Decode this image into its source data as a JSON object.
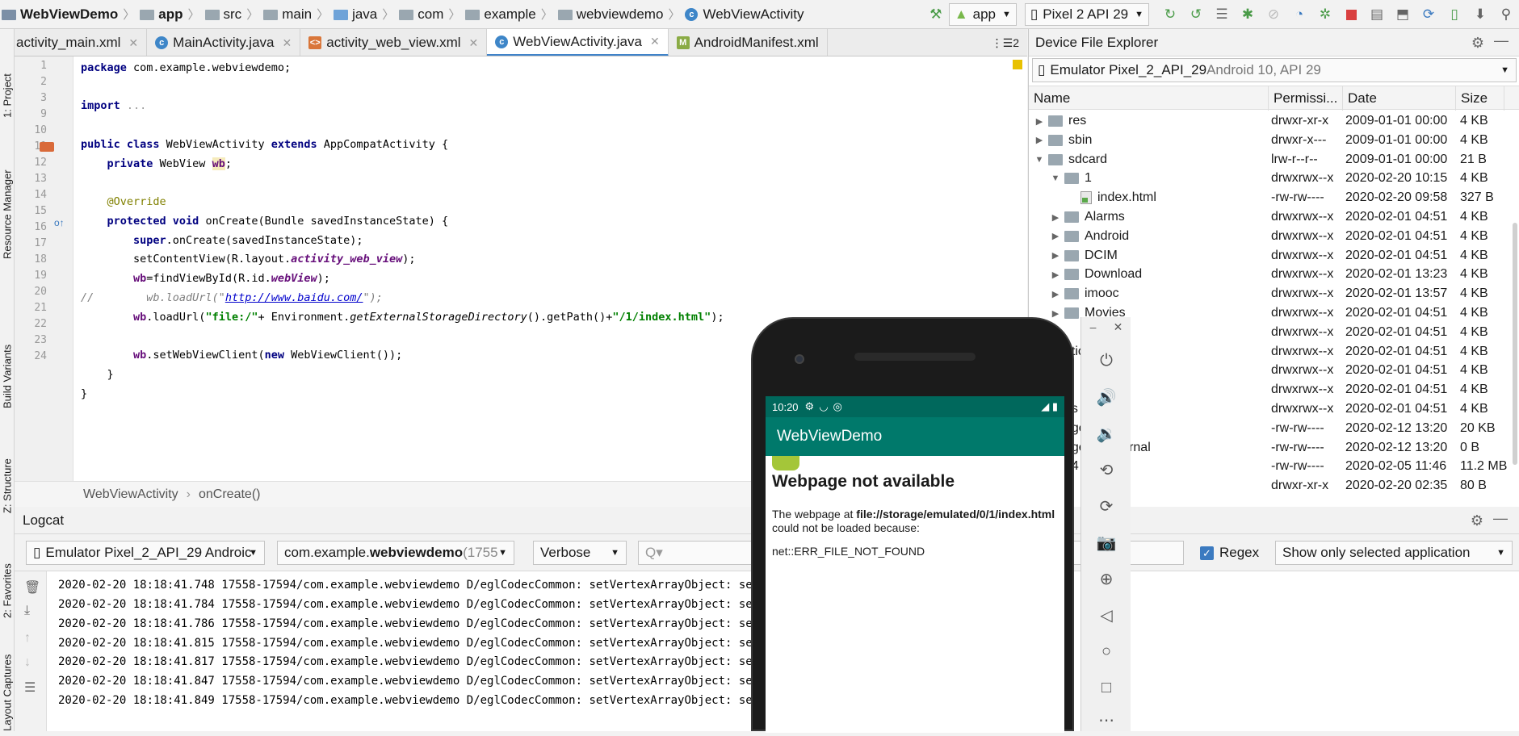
{
  "navbar": {
    "breadcrumbs": [
      {
        "label": "WebViewDemo",
        "bold": true,
        "icon": "project-icon"
      },
      {
        "label": "app",
        "bold": true,
        "icon": "module-folder-icon"
      },
      {
        "label": "src",
        "icon": "folder-icon"
      },
      {
        "label": "main",
        "icon": "folder-icon"
      },
      {
        "label": "java",
        "icon": "source-folder-icon"
      },
      {
        "label": "com",
        "icon": "folder-icon"
      },
      {
        "label": "example",
        "icon": "folder-icon"
      },
      {
        "label": "webviewdemo",
        "icon": "folder-icon"
      },
      {
        "label": "WebViewActivity",
        "icon": "class-icon"
      }
    ],
    "run_config": "app",
    "device": "Pixel 2 API 29"
  },
  "side_tools": {
    "project": "1: Project",
    "resource_manager": "Resource Manager",
    "build_variants": "Build Variants",
    "structure": "Z: Structure",
    "favorites": "2: Favorites",
    "layout_captures": "Layout Captures"
  },
  "tabs": [
    {
      "label": "activity_main.xml",
      "type": "xml",
      "active": false
    },
    {
      "label": "MainActivity.java",
      "type": "class",
      "active": false
    },
    {
      "label": "activity_web_view.xml",
      "type": "xml",
      "active": false
    },
    {
      "label": "WebViewActivity.java",
      "type": "class",
      "active": true
    },
    {
      "label": "AndroidManifest.xml",
      "type": "manifest",
      "active": false
    }
  ],
  "tabs_overflow": "2",
  "editor": {
    "line_numbers": [
      "1",
      "2",
      "3",
      "9",
      "10",
      "11",
      "12",
      "13",
      "14",
      "15",
      "16",
      "17",
      "18",
      "19",
      "20",
      "21",
      "22",
      "23",
      "24"
    ],
    "lines": {
      "l1a": "package",
      "l1b": " com.example.webviewdemo;",
      "l3a": "import",
      "l3b": " ...",
      "l10a": "public class",
      "l10b": " WebViewActivity ",
      "l10c": "extends",
      "l10d": " AppCompatActivity {",
      "l11a": "    private",
      "l11b": " WebView ",
      "l11c": "wb",
      "l11d": ";",
      "l13": "    @Override",
      "l14a": "    protected void",
      "l14b": " onCreate(Bundle savedInstanceState) {",
      "l15a": "        super",
      "l15b": ".onCreate(savedInstanceState);",
      "l16a": "        setContentView(R.layout.",
      "l16b": "activity_web_view",
      "l16c": ");",
      "l17a": "        wb",
      "l17b": "=findViewById(R.id.",
      "l17c": "webView",
      "l17d": ");",
      "l18a": "//        wb.loadUrl(\"",
      "l18b": "http://www.baidu.com/",
      "l18c": "\");",
      "l19a": "        wb",
      "l19b": ".loadUrl(",
      "l19c": "\"file:/\"",
      "l19d": "+ Environment.",
      "l19e": "getExternalStorageDirectory",
      "l19f": "().getPath()+",
      "l19g": "\"/1/index.html\"",
      "l19h": ");",
      "l21a": "        wb",
      "l21b": ".setWebViewClient(",
      "l21c": "new",
      "l21d": " WebViewClient());",
      "l22": "    }",
      "l23": "}"
    },
    "breadcrumb_class": "WebViewActivity",
    "breadcrumb_method": "onCreate()"
  },
  "logcat": {
    "title": "Logcat",
    "device": "Emulator Pixel_2_API_29 Androic",
    "package_prefix": "com.example.",
    "package_bold": "webviewdemo",
    "package_pid": " (1755",
    "level": "Verbose",
    "search_placeholder": "Q▾",
    "regex_label": "Regex",
    "regex_checked": true,
    "filter": "Show only selected application",
    "lines": [
      "2020-02-20 18:18:41.748 17558-17594/com.example.webviewdemo D/eglCodecCommon: setVertexArrayObject: set vao",
      "2020-02-20 18:18:41.784 17558-17594/com.example.webviewdemo D/eglCodecCommon: setVertexArrayObject: set vao",
      "2020-02-20 18:18:41.786 17558-17594/com.example.webviewdemo D/eglCodecCommon: setVertexArrayObject: set vao",
      "2020-02-20 18:18:41.815 17558-17594/com.example.webviewdemo D/eglCodecCommon: setVertexArrayObject: set vao",
      "2020-02-20 18:18:41.817 17558-17594/com.example.webviewdemo D/eglCodecCommon: setVertexArrayObject: set vao",
      "2020-02-20 18:18:41.847 17558-17594/com.example.webviewdemo D/eglCodecCommon: setVertexArrayObject: set vao",
      "2020-02-20 18:18:41.849 17558-17594/com.example.webviewdemo D/eglCodecCommon: setVertexArrayObject: set vao"
    ]
  },
  "file_explorer": {
    "title": "Device File Explorer",
    "device_name": "Emulator Pixel_2_API_29",
    "device_detail": " Android 10, API 29",
    "columns": [
      "Name",
      "Permissi...",
      "Date",
      "Size"
    ],
    "rows": [
      {
        "name": "res",
        "perm": "drwxr-xr-x",
        "date": "2009-01-01 00:00",
        "size": "4 KB",
        "depth": 0,
        "tri": "▶",
        "kind": "folder"
      },
      {
        "name": "sbin",
        "perm": "drwxr-x---",
        "date": "2009-01-01 00:00",
        "size": "4 KB",
        "depth": 0,
        "tri": "▶",
        "kind": "folder"
      },
      {
        "name": "sdcard",
        "perm": "lrw-r--r--",
        "date": "2009-01-01 00:00",
        "size": "21 B",
        "depth": 0,
        "tri": "▼",
        "kind": "folder"
      },
      {
        "name": "1",
        "perm": "drwxrwx--x",
        "date": "2020-02-20 10:15",
        "size": "4 KB",
        "depth": 1,
        "tri": "▼",
        "kind": "folder"
      },
      {
        "name": "index.html",
        "perm": "-rw-rw----",
        "date": "2020-02-20 09:58",
        "size": "327 B",
        "depth": 2,
        "tri": "",
        "kind": "file"
      },
      {
        "name": "Alarms",
        "perm": "drwxrwx--x",
        "date": "2020-02-01 04:51",
        "size": "4 KB",
        "depth": 1,
        "tri": "▶",
        "kind": "folder"
      },
      {
        "name": "Android",
        "perm": "drwxrwx--x",
        "date": "2020-02-01 04:51",
        "size": "4 KB",
        "depth": 1,
        "tri": "▶",
        "kind": "folder"
      },
      {
        "name": "DCIM",
        "perm": "drwxrwx--x",
        "date": "2020-02-01 04:51",
        "size": "4 KB",
        "depth": 1,
        "tri": "▶",
        "kind": "folder"
      },
      {
        "name": "Download",
        "perm": "drwxrwx--x",
        "date": "2020-02-01 13:23",
        "size": "4 KB",
        "depth": 1,
        "tri": "▶",
        "kind": "folder"
      },
      {
        "name": "imooc",
        "perm": "drwxrwx--x",
        "date": "2020-02-01 13:57",
        "size": "4 KB",
        "depth": 1,
        "tri": "▶",
        "kind": "folder"
      },
      {
        "name": "Movies",
        "perm": "drwxrwx--x",
        "date": "2020-02-01 04:51",
        "size": "4 KB",
        "depth": 1,
        "tri": "▶",
        "kind": "folder"
      },
      {
        "name": "",
        "perm": "drwxrwx--x",
        "date": "2020-02-01 04:51",
        "size": "4 KB",
        "depth": 1,
        "tri": "",
        "kind": "none"
      },
      {
        "name": "ations",
        "perm": "drwxrwx--x",
        "date": "2020-02-01 04:51",
        "size": "4 KB",
        "depth": 1,
        "tri": "",
        "kind": "none"
      },
      {
        "name": "",
        "perm": "drwxrwx--x",
        "date": "2020-02-01 04:51",
        "size": "4 KB",
        "depth": 1,
        "tri": "",
        "kind": "none"
      },
      {
        "name": "",
        "perm": "drwxrwx--x",
        "date": "2020-02-01 04:51",
        "size": "4 KB",
        "depth": 1,
        "tri": "",
        "kind": "none"
      },
      {
        "name": "es",
        "perm": "drwxrwx--x",
        "date": "2020-02-01 04:51",
        "size": "4 KB",
        "depth": 1,
        "tri": "",
        "kind": "none"
      },
      {
        "name": "nger.db",
        "perm": "-rw-rw----",
        "date": "2020-02-12 13:20",
        "size": "20 KB",
        "depth": 1,
        "tri": "",
        "kind": "none"
      },
      {
        "name": "nger.db-journal",
        "perm": "-rw-rw----",
        "date": "2020-02-12 13:20",
        "size": "0 B",
        "depth": 1,
        "tri": "",
        "kind": "none"
      },
      {
        "name": "p4",
        "perm": "-rw-rw----",
        "date": "2020-02-05 11:46",
        "size": "11.2 MB",
        "depth": 1,
        "tri": "",
        "kind": "none"
      },
      {
        "name": "",
        "perm": "drwxr-xr-x",
        "date": "2020-02-20 02:35",
        "size": "80 B",
        "depth": 0,
        "tri": "",
        "kind": "none"
      }
    ]
  },
  "emulator": {
    "status_time": "10:20",
    "app_title": "WebViewDemo",
    "error_title": "Webpage not available",
    "error_pre": "The webpage at ",
    "error_url": "file://storage/emulated/0/1/index.html",
    "error_post": " could not be loaded because:",
    "error_code": "net::ERR_FILE_NOT_FOUND",
    "controls": [
      "power-icon",
      "volume-up-icon",
      "volume-down-icon",
      "rotate-left-icon",
      "rotate-right-icon",
      "camera-icon",
      "zoom-icon",
      "back-icon",
      "home-icon",
      "overview-icon",
      "more-icon"
    ]
  }
}
